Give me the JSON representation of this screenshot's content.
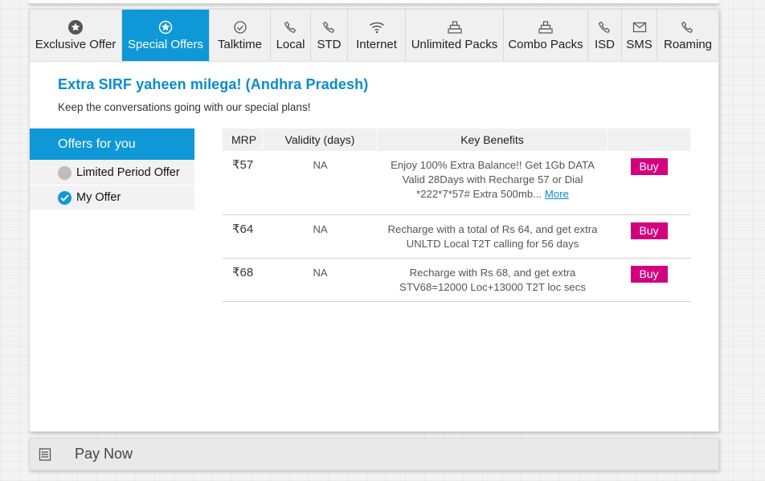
{
  "tabs": [
    {
      "label": "Exclusive Offer",
      "icon": "star-badge-icon"
    },
    {
      "label": "Special Offers",
      "icon": "star-circle-icon",
      "active": true
    },
    {
      "label": "Talktime",
      "icon": "gauge-icon"
    },
    {
      "label": "Local",
      "icon": "phone-icon"
    },
    {
      "label": "STD",
      "icon": "phone-icon"
    },
    {
      "label": "Internet",
      "icon": "wifi-icon"
    },
    {
      "label": "Unlimited Packs",
      "icon": "stack-icon"
    },
    {
      "label": "Combo Packs",
      "icon": "stack-icon"
    },
    {
      "label": "ISD",
      "icon": "phone-icon"
    },
    {
      "label": "SMS",
      "icon": "envelope-icon"
    },
    {
      "label": "Roaming",
      "icon": "phone-icon"
    }
  ],
  "headline": "Extra SIRF yaheen milega! (Andhra Pradesh)",
  "subline": "Keep the conversations going with our special plans!",
  "sidebar": {
    "title": "Offers for you",
    "items": [
      {
        "label": "Limited Period Offer",
        "selected": false
      },
      {
        "label": "My Offer",
        "selected": true
      }
    ]
  },
  "table": {
    "headers": {
      "mrp": "MRP",
      "validity": "Validity (days)",
      "benefits": "Key Benefits"
    },
    "rows": [
      {
        "mrp": "₹57",
        "validity": "NA",
        "benefits": "Enjoy 100% Extra Balance!! Get 1Gb DATA Valid 28Days with Recharge 57 or Dial *222*7*57# Extra 500mb...",
        "more": "More",
        "buy": "Buy"
      },
      {
        "mrp": "₹64",
        "validity": "NA",
        "benefits": "Recharge with a total of Rs 64, and get extra UNLTD Local T2T calling for 56 days",
        "buy": "Buy"
      },
      {
        "mrp": "₹68",
        "validity": "NA",
        "benefits": "Recharge with Rs 68, and get extra STV68=12000 Loc+13000 T2T loc secs",
        "buy": "Buy"
      }
    ]
  },
  "footer": {
    "pay_label": "Pay Now",
    "icon": "receipt-icon"
  },
  "colors": {
    "accent": "#0f98d7",
    "buy": "#d2007f",
    "headline": "#0a8ccc"
  }
}
